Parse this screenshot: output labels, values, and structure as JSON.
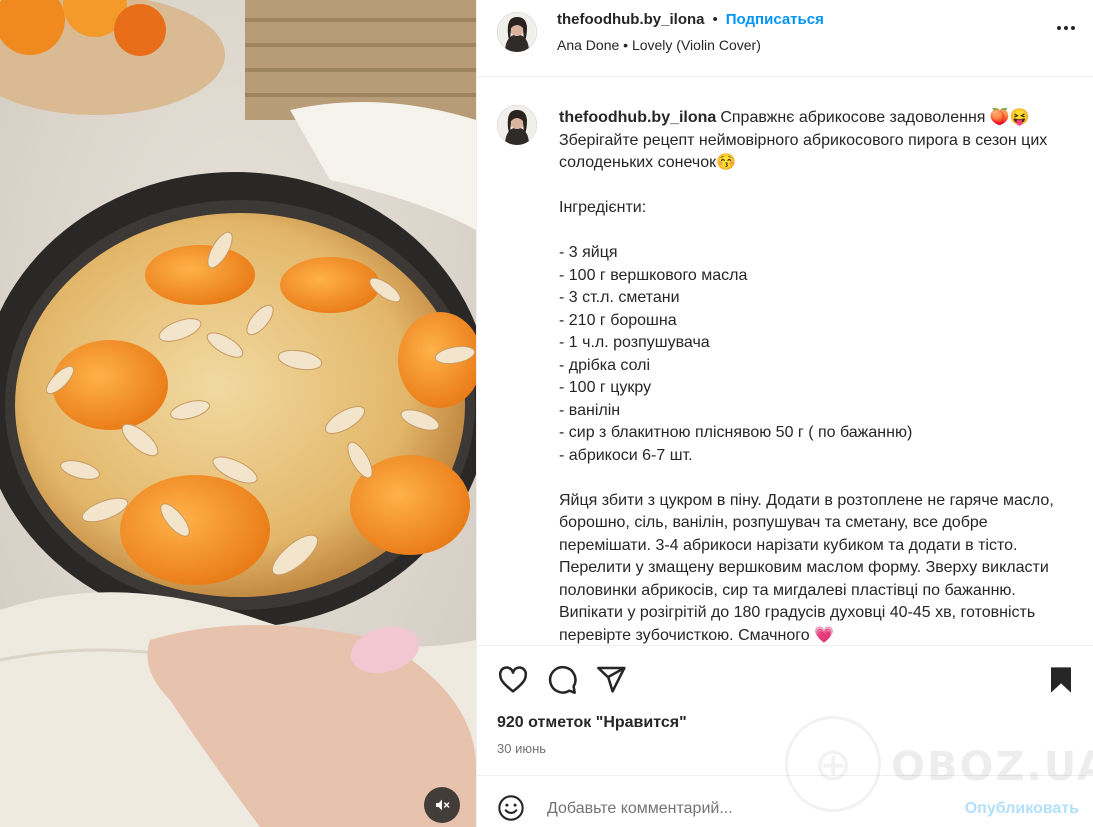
{
  "post": {
    "username": "thefoodhub.by_ilona",
    "separator": "•",
    "follow_label": "Подписаться",
    "audio": "Ana Done • Lovely (Violin Cover)",
    "more_icon": "more-horizontal-icon"
  },
  "caption": {
    "username": "thefoodhub.by_ilona",
    "text": "Справжнє абрикосове задоволення 🍑😝\nЗберігайте рецепт неймовірного абрикосового пирога в сезон цих солоденьких сонечок😚\n\nІнгредієнти:\n\n- 3 яйця\n- 100 г вершкового масла\n- 3 ст.л. сметани\n- 210 г борошна\n- 1 ч.л. розпушувача\n- дрібка солі\n- 100 г цукру\n- ванілін\n- сир з блакитною пліснявою 50 г ( по бажанню)\n- абрикоси 6-7 шт.\n\nЯйця збити з цукром в піну. Додати в розтоплене не гаряче масло, борошно, сіль, ванілін, розпушувач та сметану, все добре перемішати. 3-4 абрикоси нарізати кубиком та додати в тісто. Перелити у змащену вершковим маслом форму. Зверху викласти половинки абрикосів, сир та мигдалеві пластівці по бажанню. Випікати у розігрітій до 180 градусів духовці 40-45 хв, готовність перевірте зубочисткою. Смачного 💗"
  },
  "actions": {
    "likes": "920 отметок \"Нравится\"",
    "date": "30 июнь",
    "icons": [
      "heart-icon",
      "comment-icon",
      "share-icon",
      "bookmark-icon"
    ]
  },
  "comment": {
    "placeholder": "Добавьте комментарий...",
    "publish_label": "Опубликовать"
  },
  "watermark": {
    "text": "OBOZ.UA"
  },
  "colors": {
    "accent": "#0095f6",
    "publish_disabled": "#b2dffc",
    "border": "#efefef"
  }
}
